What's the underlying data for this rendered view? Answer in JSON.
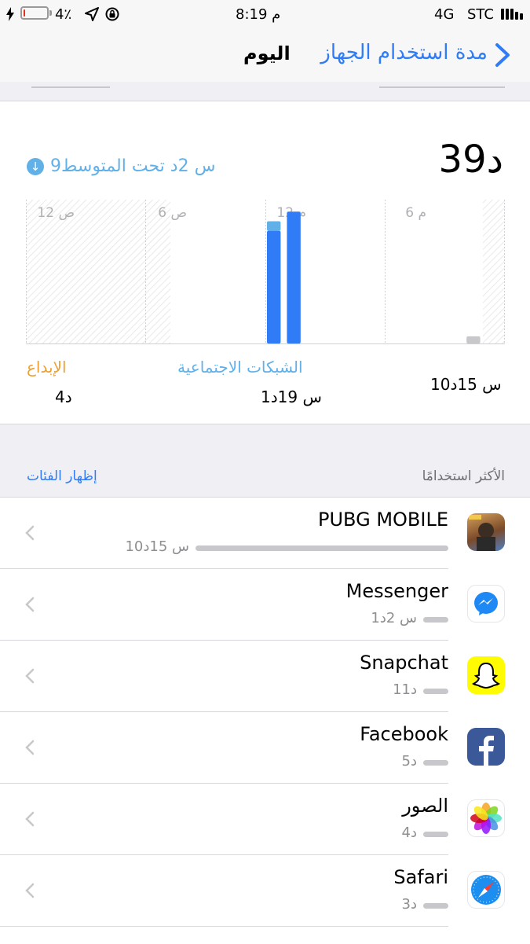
{
  "status_bar": {
    "battery": "4٪",
    "time": "8:19 م",
    "network": "4G",
    "carrier": "STC",
    "battery_level": 0.04
  },
  "nav": {
    "title": "اليوم",
    "back_label": "مدة استخدام الجهاز"
  },
  "summary": {
    "total": "39د",
    "average_text": "9س 2د تحت المتوسط",
    "average_icon": "arrow-down-circle-icon",
    "accent_color": "#62b0e8"
  },
  "chart_data": {
    "type": "bar",
    "x_tick_labels": [
      "12 ص",
      "6 ص",
      "12 م",
      "6 م"
    ],
    "series": [
      {
        "name": "الشبكات الاجتماعية",
        "color": "#2f7cf6"
      },
      {
        "name": "الإبداع",
        "color": "#f0a030"
      },
      {
        "name": "",
        "color": "#c7c7cc"
      }
    ],
    "bars": [
      {
        "hour": 12,
        "segments": [
          {
            "series": "الشبكات الاجتماعية",
            "minutes": 47
          },
          {
            "series": "other",
            "minutes": 4
          }
        ]
      },
      {
        "hour": 13,
        "segments": [
          {
            "series": "الشبكات الاجتماعية",
            "minutes": 55
          }
        ]
      },
      {
        "hour": 22,
        "segments": [
          {
            "series": "",
            "minutes": 3
          }
        ]
      }
    ],
    "ylim": [
      0,
      60
    ]
  },
  "categories": [
    {
      "name": "الإبداع",
      "time": "4د",
      "color": "#f0a030"
    },
    {
      "name": "الشبكات الاجتماعية",
      "time": "1س 19د",
      "color": "#62b0e8"
    },
    {
      "name": "",
      "time": "10س 15د",
      "color": "#000000"
    }
  ],
  "section": {
    "show_categories": "إظهار الفئات",
    "most_used": "الأكثر استخدامًا"
  },
  "apps": [
    {
      "name": "PUBG MOBILE",
      "time": "10س 15د",
      "icon": "pubg-icon",
      "fraction": 1.0
    },
    {
      "name": "Messenger",
      "time": "1س 2د",
      "icon": "messenger-icon",
      "fraction": 0.1
    },
    {
      "name": "Snapchat",
      "time": "11د",
      "icon": "snapchat-icon",
      "fraction": 0.018
    },
    {
      "name": "Facebook",
      "time": "5د",
      "icon": "facebook-icon",
      "fraction": 0.008
    },
    {
      "name": "الصور",
      "time": "4د",
      "icon": "photos-icon",
      "fraction": 0.006
    },
    {
      "name": "Safari",
      "time": "3د",
      "icon": "safari-icon",
      "fraction": 0.005
    }
  ]
}
